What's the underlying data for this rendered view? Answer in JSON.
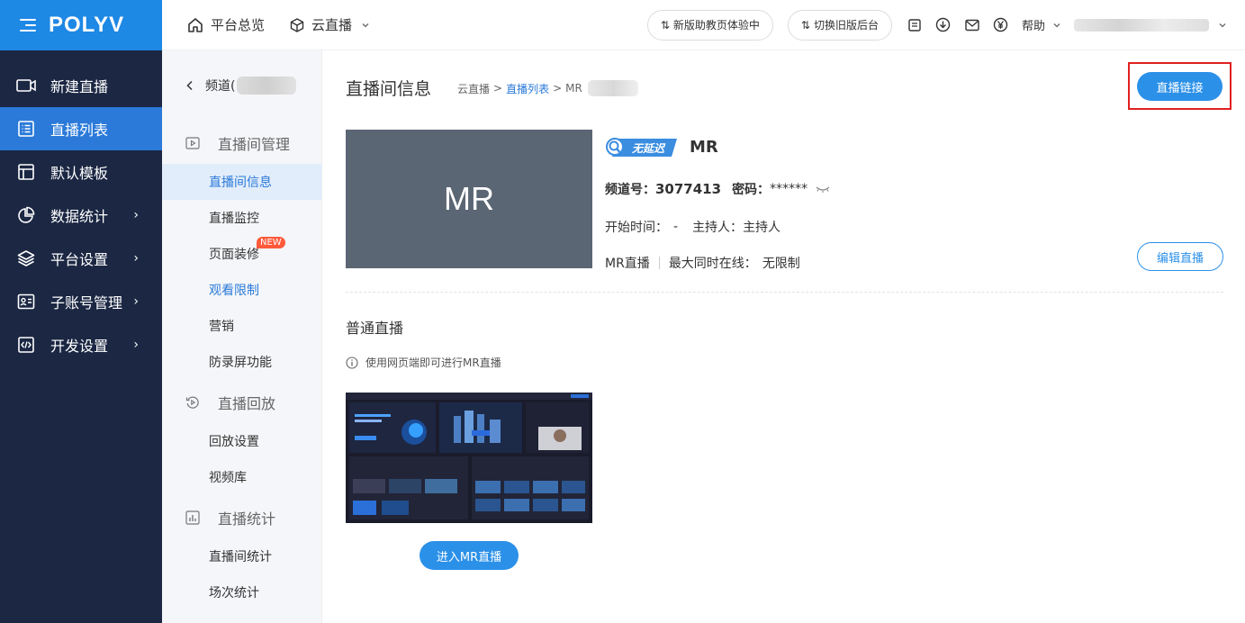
{
  "brand": {
    "logo": "POLYV"
  },
  "sidebar": {
    "items": [
      {
        "label": "新建直播",
        "icon": "video-camera-icon",
        "has_arrow": false,
        "active": false
      },
      {
        "label": "直播列表",
        "icon": "list-icon",
        "has_arrow": false,
        "active": true
      },
      {
        "label": "默认模板",
        "icon": "template-icon",
        "has_arrow": false,
        "active": false
      },
      {
        "label": "数据统计",
        "icon": "pie-chart-icon",
        "has_arrow": true,
        "active": false
      },
      {
        "label": "平台设置",
        "icon": "layers-icon",
        "has_arrow": true,
        "active": false
      },
      {
        "label": "子账号管理",
        "icon": "id-card-icon",
        "has_arrow": true,
        "active": false
      },
      {
        "label": "开发设置",
        "icon": "code-icon",
        "has_arrow": true,
        "active": false
      }
    ],
    "arrow": "›"
  },
  "header": {
    "overview": "平台总览",
    "cloud_live": "云直播",
    "new_ui_btn": "新版助教页体验中",
    "old_ui_btn": "切换旧版后台",
    "help": "帮助"
  },
  "subnav": {
    "back_label": "频道(",
    "groups": [
      {
        "label": "直播间管理",
        "icon": "play-screen-icon",
        "items": [
          {
            "label": "直播间信息",
            "state": "active"
          },
          {
            "label": "直播监控",
            "state": ""
          },
          {
            "label": "页面装修",
            "state": "",
            "badge": "NEW"
          },
          {
            "label": "观看限制",
            "state": "link"
          },
          {
            "label": "营销",
            "state": ""
          },
          {
            "label": "防录屏功能",
            "state": ""
          }
        ]
      },
      {
        "label": "直播回放",
        "icon": "replay-icon",
        "items": [
          {
            "label": "回放设置",
            "state": ""
          },
          {
            "label": "视频库",
            "state": ""
          }
        ]
      },
      {
        "label": "直播统计",
        "icon": "bar-chart-icon",
        "items": [
          {
            "label": "直播间统计",
            "state": ""
          },
          {
            "label": "场次统计",
            "state": ""
          }
        ]
      }
    ]
  },
  "main": {
    "title": "直播间信息",
    "breadcrumb": {
      "root": "云直播",
      "sep": ">",
      "link": "直播列表",
      "current": "MR"
    },
    "live_link_btn": "直播链接",
    "cover_text": "MR",
    "badge_text": "无延迟",
    "room_name": "MR",
    "channel_label": "频道号：",
    "channel_no": "3077413",
    "password_label": "密码：",
    "password": "******",
    "start_time_label": "开始时间：",
    "start_time": "-",
    "host_label": "主持人：",
    "host": "主持人",
    "live_type": "MR直播",
    "max_online_label": "最大同时在线：",
    "max_online": "无限制",
    "edit_btn": "编辑直播",
    "section_title": "普通直播",
    "tip": "使用网页端即可进行MR直播",
    "enter_btn": "进入MR直播"
  },
  "colors": {
    "primary": "#2b90e8",
    "sidebar_bg": "#1b2743",
    "brand_bg": "#1e88e5",
    "highlight": "#e02020"
  }
}
